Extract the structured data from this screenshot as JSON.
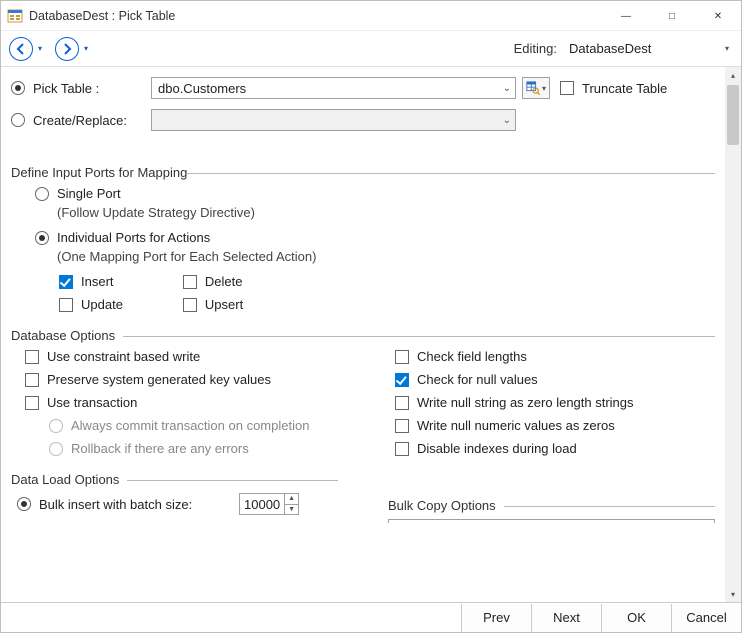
{
  "window": {
    "title": "DatabaseDest : Pick Table"
  },
  "toolbar": {
    "editing_label": "Editing:",
    "editing_value": "DatabaseDest"
  },
  "pick_table": {
    "radio_label": "Pick Table :",
    "selected": true,
    "value": "dbo.Customers",
    "truncate_label": "Truncate Table",
    "truncate_checked": false
  },
  "create_replace": {
    "radio_label": "Create/Replace:",
    "selected": false,
    "value": ""
  },
  "input_ports": {
    "title": "Define Input Ports for Mapping",
    "single": {
      "label": "Single Port",
      "sub": "(Follow Update Strategy Directive)",
      "selected": false
    },
    "individual": {
      "label": "Individual Ports for Actions",
      "sub": "(One Mapping Port for Each Selected Action)",
      "selected": true,
      "actions": {
        "insert": {
          "label": "Insert",
          "checked": true
        },
        "update": {
          "label": "Update",
          "checked": false
        },
        "delete": {
          "label": "Delete",
          "checked": false
        },
        "upsert": {
          "label": "Upsert",
          "checked": false
        }
      }
    }
  },
  "db_options": {
    "title": "Database  Options",
    "left": {
      "constraint_write": {
        "label": "Use constraint based write",
        "checked": false
      },
      "preserve_keys": {
        "label": "Preserve system generated key values",
        "checked": false
      },
      "use_transaction": {
        "label": "Use transaction",
        "checked": false
      },
      "always_commit": {
        "label": "Always commit transaction on completion",
        "checked": false,
        "enabled": false
      },
      "rollback": {
        "label": "Rollback if there are any errors",
        "checked": false,
        "enabled": false
      }
    },
    "right": {
      "check_lengths": {
        "label": "Check field lengths",
        "checked": false
      },
      "check_nulls": {
        "label": "Check for null values",
        "checked": true
      },
      "null_string": {
        "label": "Write null string as zero length strings",
        "checked": false
      },
      "null_numeric": {
        "label": "Write null numeric values as zeros",
        "checked": false
      },
      "disable_index": {
        "label": "Disable indexes during load",
        "checked": false
      }
    }
  },
  "data_load": {
    "title": "Data Load Options",
    "bulk_insert": {
      "label": "Bulk insert with batch size:",
      "selected": true,
      "value": "10000"
    }
  },
  "bulk_copy": {
    "title": "Bulk Copy Options"
  },
  "buttons": {
    "prev": "Prev",
    "next": "Next",
    "ok": "OK",
    "cancel": "Cancel"
  }
}
